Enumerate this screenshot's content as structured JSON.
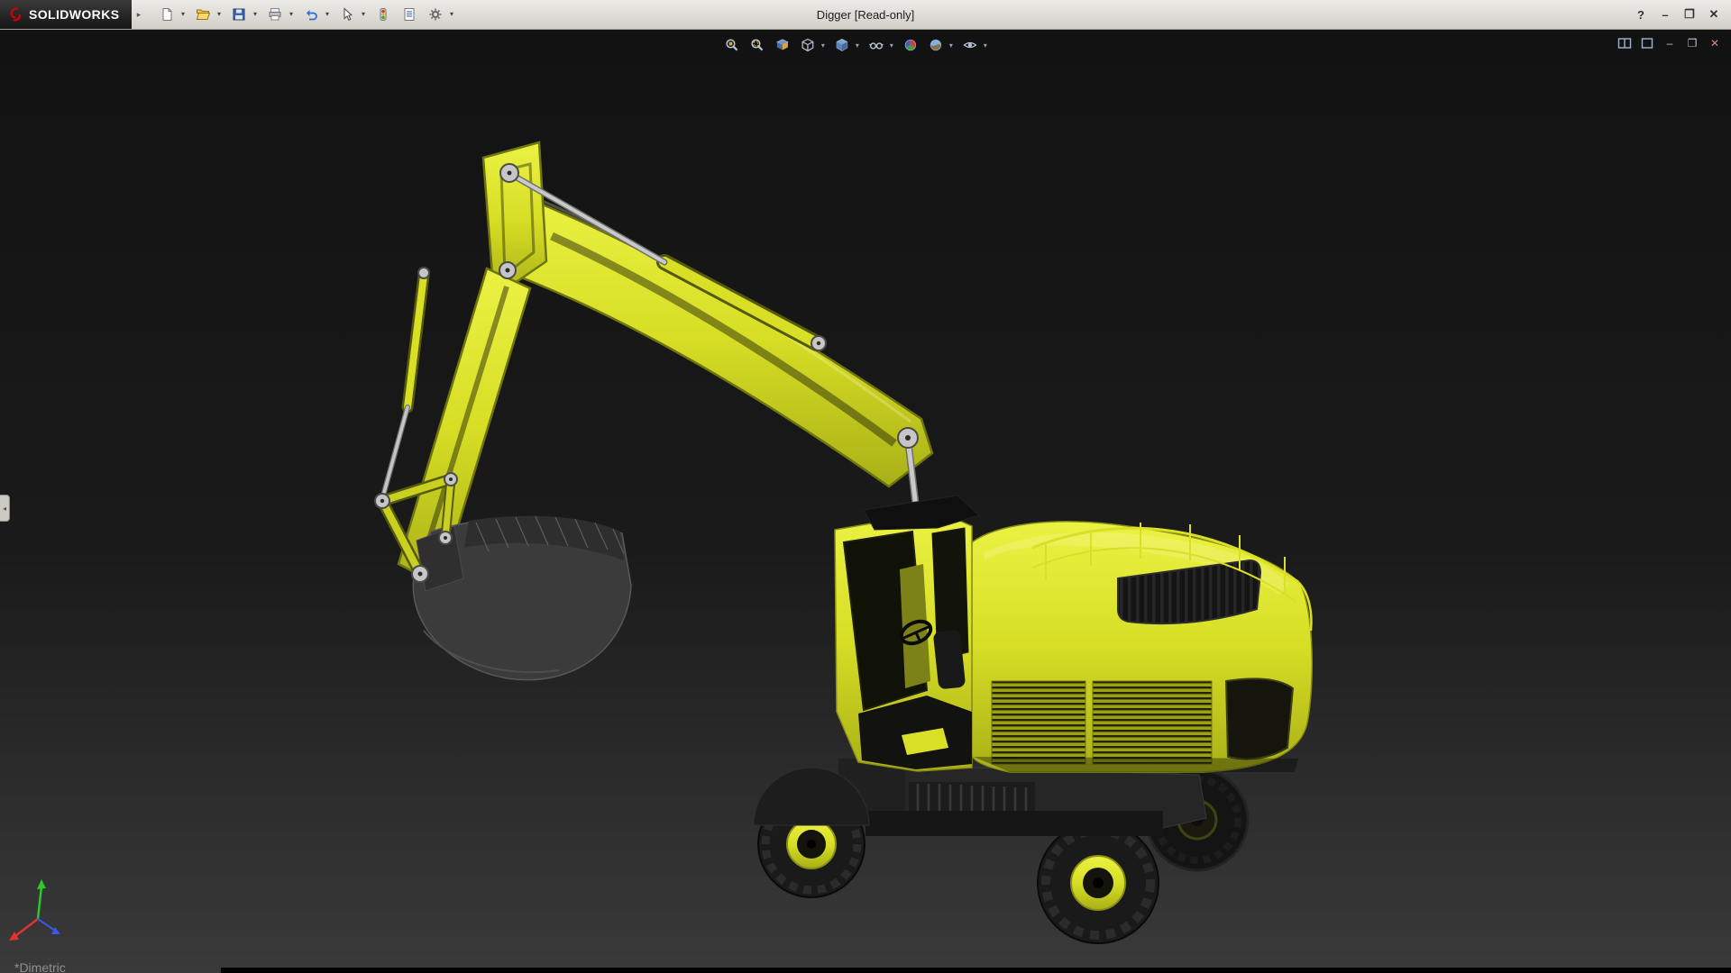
{
  "titlebar": {
    "brand": "SOLIDWORKS",
    "title": "Digger [Read-only]"
  },
  "glyphs": {
    "flyout": "▸",
    "dropdown": "▾",
    "help": "?",
    "minimize": "–",
    "restore": "❐",
    "close": "✕",
    "collapse_left": "◂"
  },
  "main_toolbar": {
    "items": [
      {
        "name": "new-document",
        "dropdown": true
      },
      {
        "name": "open",
        "dropdown": true
      },
      {
        "name": "save",
        "dropdown": true
      },
      {
        "name": "print",
        "dropdown": true
      },
      {
        "name": "undo",
        "dropdown": true
      },
      {
        "name": "select",
        "dropdown": true
      },
      {
        "name": "rebuild",
        "dropdown": false
      },
      {
        "name": "file-properties",
        "dropdown": false
      },
      {
        "name": "options",
        "dropdown": true
      }
    ]
  },
  "headsup_toolbar": {
    "items": [
      {
        "name": "zoom-to-fit",
        "dropdown": false
      },
      {
        "name": "zoom-to-area",
        "dropdown": false
      },
      {
        "name": "section-view",
        "dropdown": false
      },
      {
        "name": "view-orientation",
        "dropdown": true
      },
      {
        "name": "display-style",
        "dropdown": true
      },
      {
        "name": "hide-show-items",
        "dropdown": true
      },
      {
        "name": "edit-appearance",
        "dropdown": false
      },
      {
        "name": "apply-scene",
        "dropdown": true
      },
      {
        "name": "view-settings",
        "dropdown": true
      }
    ]
  },
  "doc_window_controls": {
    "items": [
      {
        "name": "split-pane-horizontal"
      },
      {
        "name": "split-pane-vertical"
      },
      {
        "name": "minimize-document"
      },
      {
        "name": "restore-document"
      },
      {
        "name": "close-document"
      }
    ]
  },
  "viewport": {
    "orientation_label": "*Dimetric"
  },
  "colors": {
    "menubar_bg_top": "#edebe7",
    "menubar_bg_bottom": "#d2cfc8",
    "brand_red": "#d40000",
    "viewport_bg_top": "#121212",
    "viewport_bg_bottom": "#3a3a3a",
    "excavator_yellow": "#d9e026",
    "excavator_yellow_dark": "#a9b017",
    "excavator_outline": "#6e7410",
    "dark_part": "#1a1a1a",
    "metal": "#c6c6c6",
    "triad_x": "#e03232",
    "triad_y": "#2fc62f",
    "triad_z": "#3a58e8"
  }
}
